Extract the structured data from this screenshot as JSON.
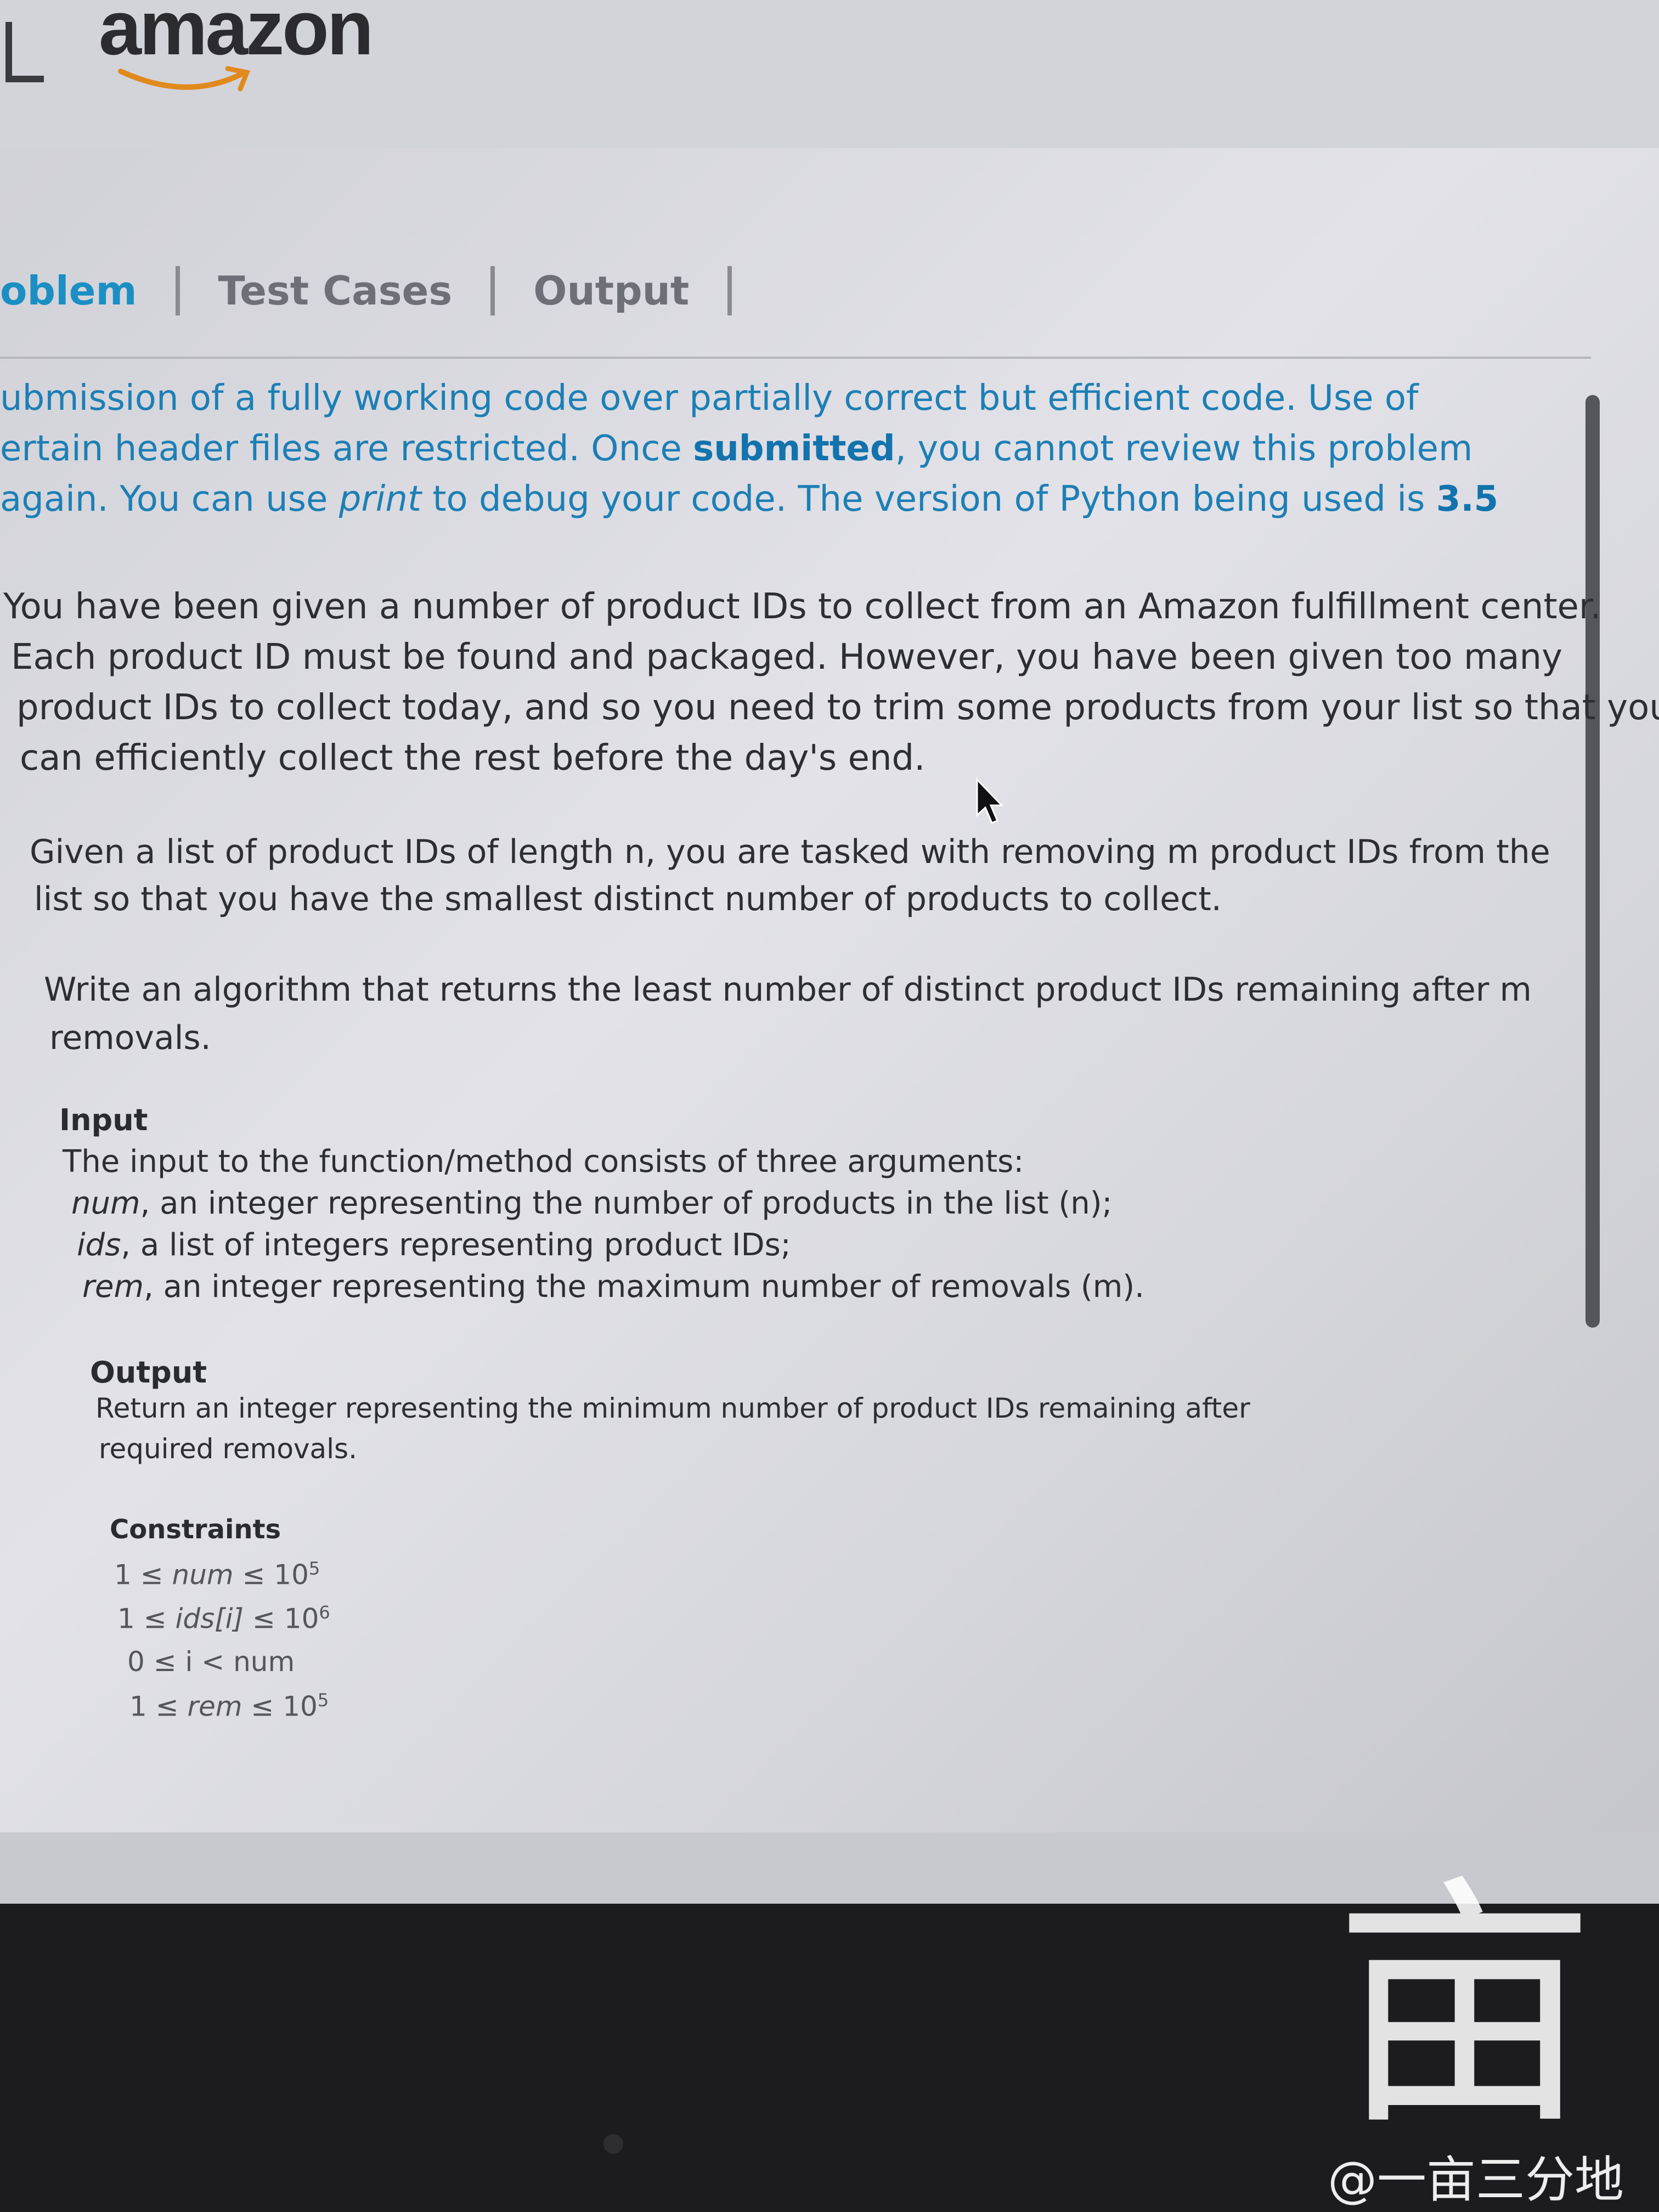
{
  "header": {
    "logo_text": "amazon"
  },
  "tabs": [
    {
      "label": "oblem",
      "active": true
    },
    {
      "label": "Test Cases",
      "active": false
    },
    {
      "label": "Output",
      "active": false
    }
  ],
  "intro": {
    "l1": "ubmission of a fully working code over partially correct but efficient code. Use of",
    "l2a": "ertain header files are restricted. Once ",
    "l2b": "submitted",
    "l2c": ", you cannot review this problem",
    "l3a": "again. You can use ",
    "l3b": "print",
    "l3c": " to debug your code. The version of Python being used is ",
    "l3d": "3.5"
  },
  "problem": {
    "p1": [
      "You have been given a number of product IDs to collect from an Amazon fulfillment center.",
      "Each product ID must be found and packaged. However, you have been given too many",
      "product IDs to collect today, and so you need to trim some products from your list so that you",
      "can efficiently collect the rest before the day's end."
    ],
    "p2": [
      "Given a list of product IDs of length n, you are tasked with removing m product IDs from the",
      "list so that you have the smallest distinct number of products to collect."
    ],
    "p3": [
      "Write an algorithm that returns the least number of distinct product IDs remaining after m",
      "removals."
    ]
  },
  "input_section": {
    "title": "Input",
    "intro": "The input to the function/method consists of three arguments:",
    "args": [
      {
        "name": "num",
        "desc": ", an integer representing the number of products in the list (n);"
      },
      {
        "name": "ids",
        "desc": ", a list of integers representing product IDs;"
      },
      {
        "name": "rem",
        "desc": ", an integer representing the maximum number of removals (m)."
      }
    ]
  },
  "output_section": {
    "title": "Output",
    "lines": [
      "Return an integer representing the minimum number of product IDs remaining after",
      "required removals."
    ]
  },
  "constraints": {
    "title": "Constraints",
    "items": [
      {
        "pre": "1 ≤ ",
        "var": "num",
        "post": " ≤ 10",
        "sup": "5"
      },
      {
        "pre": "1 ≤ ",
        "var": "ids[i]",
        "post": " ≤ 10",
        "sup": "6"
      },
      {
        "pre": "0 ≤ i < num",
        "var": "",
        "post": "",
        "sup": ""
      },
      {
        "pre": "1 ≤ ",
        "var": "rem",
        "post": " ≤ 10",
        "sup": "5"
      }
    ]
  },
  "watermark": {
    "glyph": "亩",
    "text": "@一亩三分地"
  },
  "colors": {
    "accent": "#1b8fc4",
    "text": "#2d2e33",
    "screen": "#dcdce2"
  }
}
